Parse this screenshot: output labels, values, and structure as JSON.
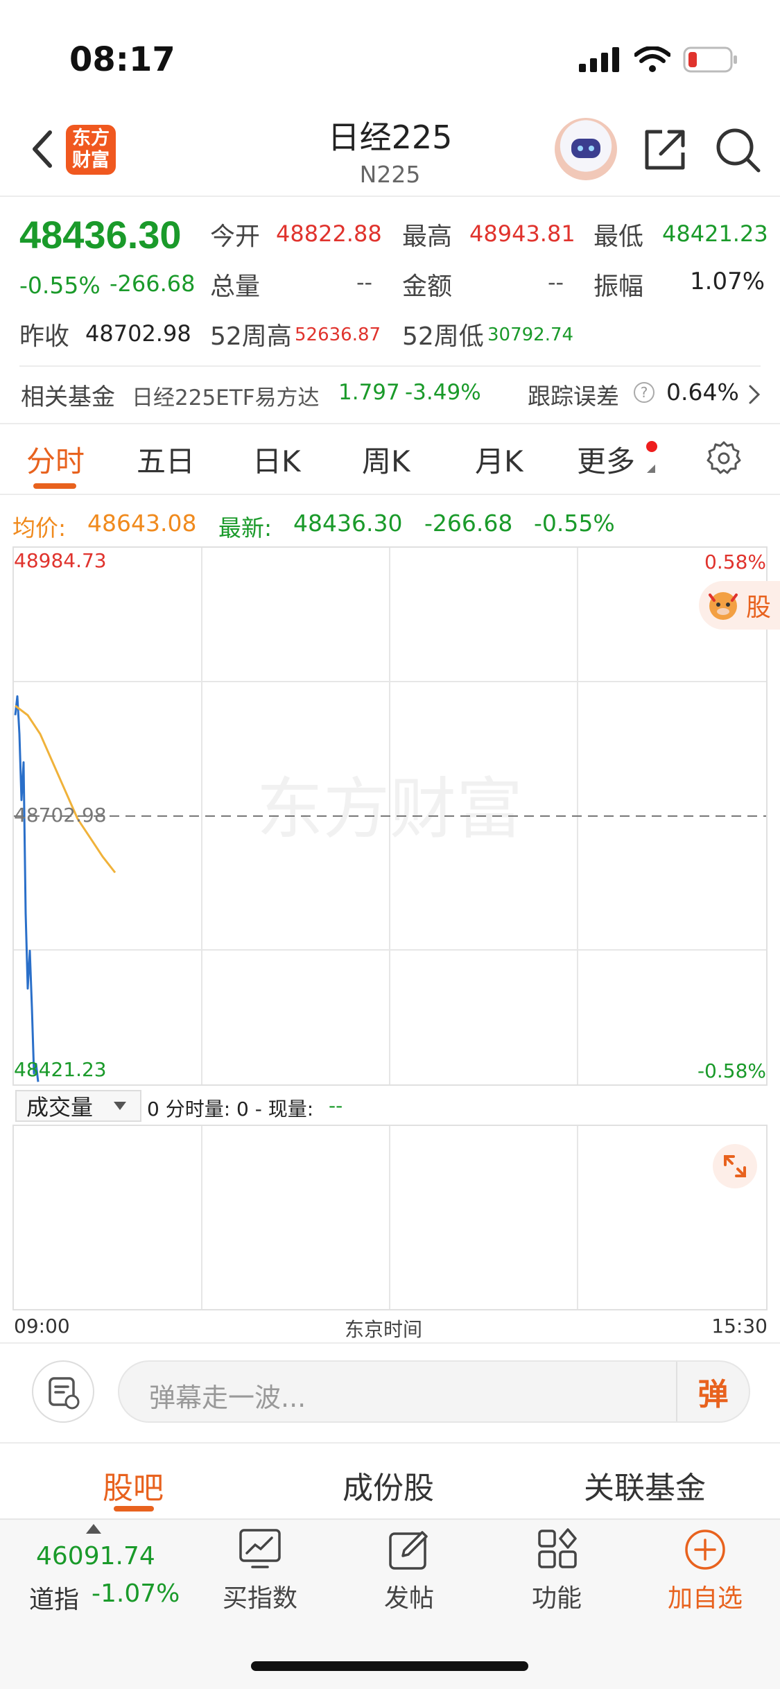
{
  "status_bar": {
    "time": "08:17"
  },
  "header": {
    "back_icon": "chevron-left-icon",
    "logo_text_1": "东方",
    "logo_text_2": "财富",
    "title": "日经225",
    "subtitle": "N225",
    "share_icon": "share-icon",
    "search_icon": "search-icon"
  },
  "quote": {
    "price": "48436.30",
    "change_pct": "-0.55%",
    "change": "-266.68",
    "open_label": "今开",
    "open": "48822.88",
    "high_label": "最高",
    "high": "48943.81",
    "low_label": "最低",
    "low": "48421.23",
    "volume_label": "总量",
    "volume": "--",
    "amount_label": "金额",
    "amount": "--",
    "amplitude_label": "振幅",
    "amplitude": "1.07%",
    "prev_close_label": "昨收",
    "prev_close": "48702.98",
    "week52_high_label": "52周高",
    "week52_high": "52636.87",
    "week52_low_label": "52周低",
    "week52_low": "30792.74"
  },
  "related_fund": {
    "label": "相关基金",
    "name": "日经225ETF易方达",
    "price": "1.797",
    "change_pct": "-3.49%",
    "tracking_label": "跟踪误差",
    "tracking_value": "0.64%"
  },
  "tabs": [
    "分时",
    "五日",
    "日K",
    "周K",
    "月K",
    "更多"
  ],
  "chart_header": {
    "avg_label": "均价:",
    "avg_value": "48643.08",
    "latest_label": "最新:",
    "latest_value": "48436.30",
    "latest_change": "-266.68",
    "latest_pct": "-0.55%"
  },
  "chart_data": {
    "type": "line",
    "y_max_label": "48984.73",
    "y_mid_label": "48702.98",
    "y_min_label": "48421.23",
    "pct_max_label": "0.58%",
    "pct_min_label": "-0.58%",
    "ylim": [
      48421.23,
      48984.73
    ],
    "watermark": "东方财富",
    "series": [
      {
        "color": "#2a6fc9",
        "values": [
          48810,
          48830,
          48790,
          48720,
          48760,
          48600,
          48520,
          48560,
          48500,
          48430,
          48440,
          48421
        ]
      },
      {
        "color": "#f0b23a",
        "values": [
          48820,
          48810,
          48790,
          48760,
          48730,
          48700,
          48680,
          48660,
          48643
        ]
      }
    ],
    "x_start": "09:00",
    "x_mid": "东京时间",
    "x_end": "15:30"
  },
  "volume_bar": {
    "selector": "成交量",
    "text": "0 分时量: 0 - 现量:",
    "current": "--"
  },
  "comment": {
    "placeholder": "弹幕走一波...",
    "button": "弹"
  },
  "bottom_tabs": [
    "股吧",
    "成份股",
    "关联基金"
  ],
  "dock": {
    "index_value": "46091.74",
    "index_name": "道指",
    "index_pct": "-1.07%",
    "items": [
      "买指数",
      "发帖",
      "功能",
      "加自选"
    ]
  },
  "stock_badge": "股"
}
